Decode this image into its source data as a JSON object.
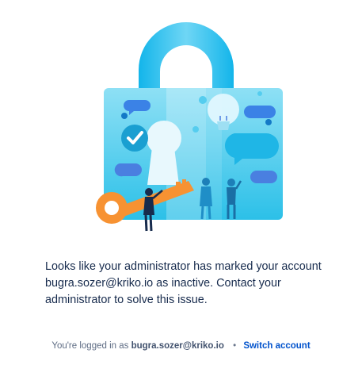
{
  "illustration": {
    "name": "locked-account-illustration",
    "colors": {
      "shackle": "#2bbde3",
      "body": "#7fd9f2",
      "key": "#f79232",
      "bubble": "#3b82f6"
    }
  },
  "message": {
    "text": "Looks like your administrator has marked your account bugra.sozer@kriko.io as inactive. Contact your administrator to solve this issue."
  },
  "footer": {
    "prefix": "You're logged in as",
    "email": "bugra.sozer@kriko.io",
    "separator": "•",
    "switch_label": "Switch account"
  },
  "colors": {
    "text": "#172b4d",
    "muted": "#5e6c84",
    "link": "#0052cc"
  }
}
